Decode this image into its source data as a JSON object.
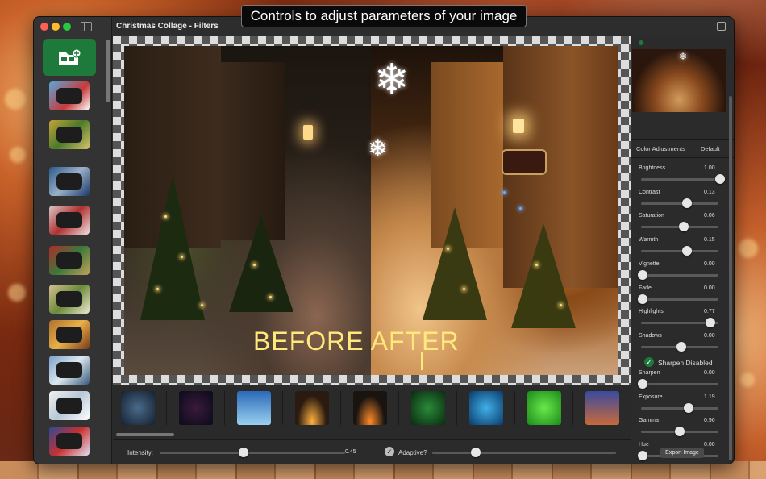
{
  "caption": "Controls to adjust parameters of your image",
  "window": {
    "title": "Christmas Collage - Filters"
  },
  "canvas": {
    "overlay_text": "BEFORE AFTER"
  },
  "bottom_bar": {
    "intensity_label": "Intensity:",
    "intensity_value": "0.45",
    "adaptive_label": "Adaptive?"
  },
  "right_panel": {
    "header": "Color Adjustments",
    "preset": "Default",
    "sliders": [
      {
        "label": "Brightness",
        "value": "1.00",
        "level": 1.0
      },
      {
        "label": "Contrast",
        "value": "0.13",
        "level": 0.57
      },
      {
        "label": "Saturation",
        "value": "0.06",
        "level": 0.53
      },
      {
        "label": "Warmth",
        "value": "0.15",
        "level": 0.57
      },
      {
        "label": "Vignette",
        "value": "0.00",
        "level": 0.0
      },
      {
        "label": "Fade",
        "value": "0.00",
        "level": 0.0
      },
      {
        "label": "Highlights",
        "value": "0.77",
        "level": 0.88
      },
      {
        "label": "Shadows",
        "value": "0.00",
        "level": 0.5
      }
    ],
    "sharpen_toggle": "Sharpen Disabled",
    "sliders2": [
      {
        "label": "Sharpen",
        "value": "0.00",
        "level": 0.0
      },
      {
        "label": "Exposure",
        "value": "1.19",
        "level": 0.59
      },
      {
        "label": "Gamma",
        "value": "0.96",
        "level": 0.48
      },
      {
        "label": "Hue",
        "value": "0.00",
        "level": 0.0
      }
    ],
    "export_label": "Export Image"
  },
  "icons": [
    "close-icon",
    "minimize-icon",
    "zoom-icon",
    "sidebar-toggle-icon",
    "add-frame-icon",
    "share-icon",
    "snowflake-icon",
    "checkmark-icon"
  ],
  "colors": {
    "accent_green": "#1e7a3a",
    "overlay_text": "#ffe97a"
  }
}
